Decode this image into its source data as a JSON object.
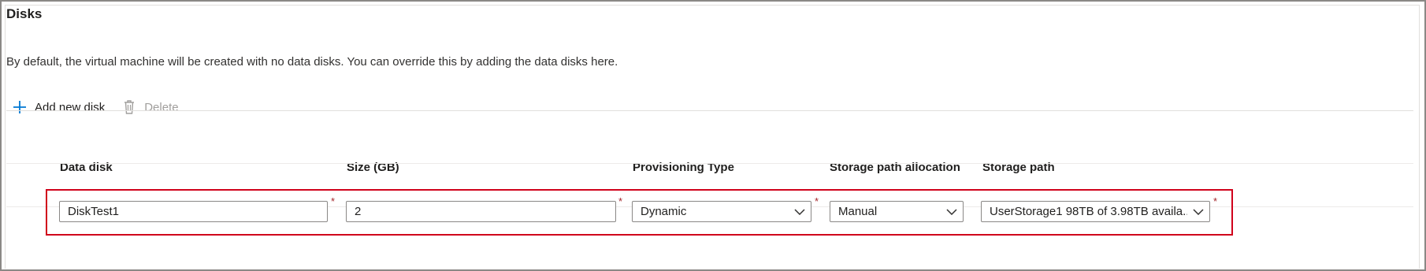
{
  "section": {
    "title": "Disks",
    "description": "By default, the virtual machine will be created with no data disks. You can override this by adding the data disks here."
  },
  "toolbar": {
    "add_label": "Add new disk",
    "delete_label": "Delete"
  },
  "table": {
    "columns": [
      "Data disk",
      "Size (GB)",
      "Provisioning Type",
      "Storage path allocation",
      "Storage path"
    ],
    "row": {
      "data_disk": "DiskTest1",
      "size_gb": "2",
      "provisioning_type": "Dynamic",
      "storage_path_allocation": "Manual",
      "storage_path": "UserStorage1 98TB of 3.98TB availa..."
    },
    "required_marker": "*"
  },
  "colors": {
    "highlight": "#d0021b",
    "accent": "#0078d4",
    "required": "#a4262c"
  }
}
